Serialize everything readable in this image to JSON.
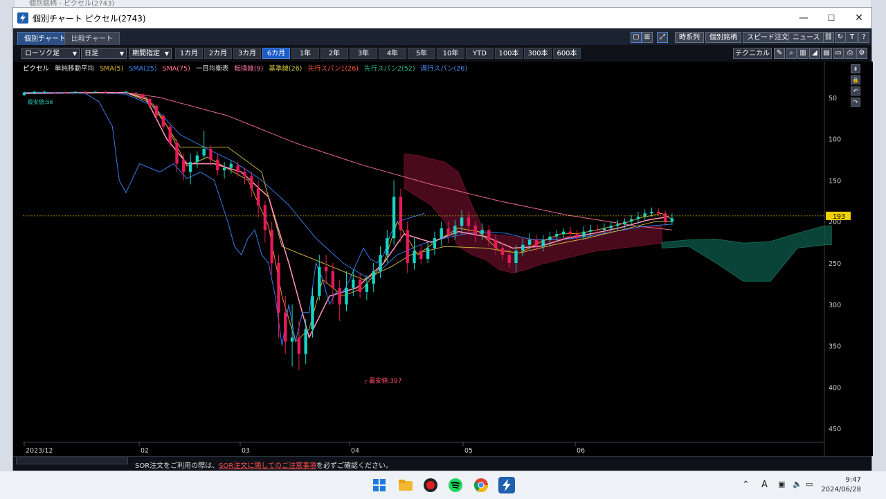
{
  "background_window_title": "個別銘柄 - ピクセル(2743)",
  "window": {
    "title": "個別チャート ピクセル(2743)",
    "min": "—",
    "max": "☐",
    "close": "✕"
  },
  "tabs": [
    {
      "label": "個別チャート"
    },
    {
      "label": "比較チャート"
    }
  ],
  "top_buttons": {
    "time_series": "時系列",
    "individual": "個別銘柄",
    "speed_order": "スピード注文",
    "news": "ニュース"
  },
  "toolbar": {
    "chart_type": "ローソク足",
    "period_type": "日足",
    "range_mode": "期間指定",
    "ranges": [
      "1カ月",
      "2カ月",
      "3カ月",
      "6カ月",
      "1年",
      "2年",
      "3年",
      "4年",
      "5年",
      "10年",
      "YTD",
      "100本",
      "300本",
      "600本"
    ],
    "active_range": "6カ月",
    "technical": "テクニカル"
  },
  "legend": {
    "name": "ピクセル",
    "sma_label": "単純移動平均",
    "sma5": "SMA(5)",
    "sma25": "SMA(25)",
    "sma75": "SMA(75)",
    "ichimoku_label": "一目均衡表",
    "tenkan": "転換線(9)",
    "kijun": "基準線(26)",
    "span1": "先行スパン1(26)",
    "span2": "先行スパン2(52)",
    "chikou": "遅行スパン(26)"
  },
  "colors": {
    "up": "#19d3c5",
    "down": "#e8195a",
    "sma5": "#d9a21b",
    "sma25": "#2f7be8",
    "sma75": "#e86a8e",
    "tenkan": "#ff8fb4",
    "kijun": "#c8b03a",
    "span1": "#e64b28",
    "span2": "#1e9a7a",
    "chikou": "#3d7be6"
  },
  "chart_data": {
    "type": "candlestick",
    "x_ticks": [
      "2023/12",
      "02",
      "03",
      "04",
      "05",
      "06"
    ],
    "y_ticks": [
      50,
      100,
      150,
      200,
      250,
      300,
      350,
      400,
      450
    ],
    "ylim": [
      475,
      30
    ],
    "y_reversed": true,
    "current_price": 193,
    "annotations": {
      "high_marker": "最安値:397",
      "low_marker": "最安値:56"
    },
    "candles": [
      [
        0,
        47,
        44,
        48,
        43
      ],
      [
        3,
        45,
        43,
        46,
        42
      ],
      [
        6,
        44,
        43,
        45,
        42
      ],
      [
        9,
        44,
        44,
        45,
        43
      ],
      [
        12,
        44,
        44,
        45,
        43
      ],
      [
        15,
        44,
        43,
        45,
        42
      ],
      [
        18,
        43,
        44,
        45,
        42
      ],
      [
        21,
        44,
        43,
        45,
        42
      ],
      [
        24,
        43,
        44,
        45,
        42
      ],
      [
        27,
        44,
        44,
        45,
        43
      ],
      [
        30,
        44,
        43,
        45,
        42
      ],
      [
        33,
        44,
        45,
        46,
        43
      ],
      [
        35,
        46,
        50,
        52,
        45
      ],
      [
        37,
        52,
        60,
        63,
        50
      ],
      [
        39,
        60,
        72,
        76,
        58
      ],
      [
        41,
        72,
        85,
        88,
        70
      ],
      [
        43,
        85,
        105,
        110,
        80
      ],
      [
        45,
        105,
        130,
        140,
        100
      ],
      [
        47,
        125,
        140,
        150,
        118
      ],
      [
        49,
        140,
        128,
        155,
        118
      ],
      [
        51,
        128,
        120,
        135,
        115
      ],
      [
        53,
        120,
        112,
        125,
        90
      ],
      [
        55,
        112,
        125,
        132,
        108
      ],
      [
        57,
        125,
        138,
        144,
        118
      ],
      [
        59,
        138,
        135,
        148,
        128
      ],
      [
        61,
        135,
        130,
        142,
        126
      ],
      [
        63,
        132,
        140,
        146,
        128
      ],
      [
        65,
        140,
        145,
        155,
        135
      ],
      [
        67,
        145,
        160,
        170,
        140
      ],
      [
        69,
        160,
        180,
        195,
        150
      ],
      [
        71,
        180,
        210,
        225,
        175
      ],
      [
        73,
        210,
        250,
        265,
        200
      ],
      [
        75,
        250,
        310,
        340,
        240
      ],
      [
        77,
        310,
        345,
        360,
        290
      ],
      [
        79,
        345,
        340,
        375,
        300
      ],
      [
        81,
        340,
        360,
        380,
        320
      ],
      [
        83,
        360,
        330,
        372,
        318
      ],
      [
        85,
        330,
        290,
        340,
        280
      ],
      [
        87,
        290,
        255,
        295,
        240
      ],
      [
        89,
        255,
        260,
        275,
        240
      ],
      [
        91,
        260,
        280,
        300,
        250
      ],
      [
        93,
        280,
        300,
        320,
        270
      ],
      [
        95,
        300,
        280,
        308,
        260
      ],
      [
        97,
        280,
        270,
        290,
        258
      ],
      [
        99,
        270,
        285,
        292,
        262
      ],
      [
        101,
        285,
        275,
        295,
        265
      ],
      [
        103,
        275,
        260,
        285,
        250
      ],
      [
        105,
        260,
        240,
        268,
        230
      ],
      [
        107,
        240,
        220,
        250,
        210
      ],
      [
        109,
        220,
        170,
        228,
        150
      ],
      [
        111,
        170,
        210,
        225,
        160
      ],
      [
        113,
        210,
        250,
        262,
        200
      ],
      [
        115,
        250,
        235,
        258,
        220
      ],
      [
        117,
        235,
        245,
        252,
        228
      ],
      [
        119,
        245,
        232,
        250,
        225
      ],
      [
        121,
        232,
        220,
        240,
        212
      ],
      [
        123,
        220,
        208,
        230,
        200
      ],
      [
        125,
        208,
        215,
        226,
        200
      ],
      [
        127,
        215,
        205,
        222,
        198
      ],
      [
        129,
        205,
        195,
        215,
        186
      ],
      [
        131,
        195,
        205,
        214,
        188
      ],
      [
        133,
        205,
        215,
        225,
        200
      ],
      [
        135,
        215,
        210,
        222,
        202
      ],
      [
        137,
        210,
        222,
        230,
        204
      ],
      [
        139,
        222,
        232,
        240,
        216
      ],
      [
        141,
        232,
        240,
        246,
        226
      ],
      [
        143,
        240,
        250,
        256,
        232
      ],
      [
        145,
        250,
        235,
        262,
        228
      ],
      [
        147,
        235,
        228,
        242,
        220
      ],
      [
        149,
        228,
        222,
        234,
        214
      ],
      [
        151,
        222,
        230,
        236,
        216
      ],
      [
        153,
        230,
        222,
        236,
        216
      ],
      [
        155,
        222,
        218,
        230,
        212
      ],
      [
        157,
        218,
        215,
        224,
        210
      ],
      [
        159,
        215,
        212,
        220,
        208
      ],
      [
        161,
        212,
        215,
        220,
        206
      ],
      [
        163,
        215,
        218,
        222,
        210
      ],
      [
        165,
        218,
        212,
        222,
        206
      ],
      [
        167,
        212,
        210,
        218,
        204
      ],
      [
        169,
        210,
        210,
        215,
        204
      ],
      [
        171,
        210,
        208,
        214,
        202
      ],
      [
        173,
        208,
        205,
        212,
        200
      ],
      [
        175,
        205,
        203,
        210,
        198
      ],
      [
        177,
        203,
        200,
        208,
        196
      ],
      [
        179,
        200,
        197,
        205,
        192
      ],
      [
        181,
        197,
        194,
        202,
        188
      ],
      [
        183,
        194,
        190,
        198,
        185
      ],
      [
        185,
        190,
        188,
        194,
        183
      ],
      [
        187,
        188,
        190,
        193,
        184
      ],
      [
        189,
        190,
        200,
        205,
        186
      ],
      [
        191,
        200,
        196,
        204,
        190
      ]
    ],
    "sma5": [
      [
        0,
        45
      ],
      [
        30,
        44
      ],
      [
        36,
        50
      ],
      [
        42,
        84
      ],
      [
        48,
        133
      ],
      [
        54,
        122
      ],
      [
        60,
        136
      ],
      [
        66,
        150
      ],
      [
        72,
        205
      ],
      [
        76,
        290
      ],
      [
        80,
        345
      ],
      [
        84,
        330
      ],
      [
        88,
        270
      ],
      [
        94,
        290
      ],
      [
        100,
        280
      ],
      [
        106,
        250
      ],
      [
        110,
        200
      ],
      [
        116,
        240
      ],
      [
        122,
        222
      ],
      [
        128,
        208
      ],
      [
        134,
        212
      ],
      [
        140,
        235
      ],
      [
        146,
        238
      ],
      [
        152,
        225
      ],
      [
        158,
        215
      ],
      [
        164,
        214
      ],
      [
        170,
        209
      ],
      [
        176,
        203
      ],
      [
        182,
        195
      ],
      [
        188,
        190
      ],
      [
        191,
        197
      ]
    ],
    "sma25": [
      [
        0,
        44
      ],
      [
        20,
        44
      ],
      [
        30,
        46
      ],
      [
        38,
        60
      ],
      [
        46,
        95
      ],
      [
        54,
        112
      ],
      [
        62,
        128
      ],
      [
        70,
        150
      ],
      [
        78,
        180
      ],
      [
        86,
        220
      ],
      [
        94,
        250
      ],
      [
        102,
        270
      ],
      [
        110,
        240
      ],
      [
        118,
        226
      ],
      [
        126,
        218
      ],
      [
        134,
        212
      ],
      [
        142,
        214
      ],
      [
        150,
        222
      ],
      [
        158,
        222
      ],
      [
        166,
        218
      ],
      [
        174,
        212
      ],
      [
        182,
        206
      ],
      [
        191,
        203
      ]
    ],
    "sma75": [
      [
        0,
        44
      ],
      [
        30,
        44
      ],
      [
        40,
        50
      ],
      [
        60,
        72
      ],
      [
        80,
        105
      ],
      [
        100,
        132
      ],
      [
        120,
        155
      ],
      [
        140,
        175
      ],
      [
        160,
        192
      ],
      [
        180,
        205
      ],
      [
        191,
        210
      ]
    ],
    "tenkan": [
      [
        0,
        45
      ],
      [
        30,
        44
      ],
      [
        36,
        52
      ],
      [
        42,
        100
      ],
      [
        48,
        130
      ],
      [
        56,
        130
      ],
      [
        64,
        140
      ],
      [
        72,
        170
      ],
      [
        78,
        250
      ],
      [
        84,
        340
      ],
      [
        90,
        290
      ],
      [
        98,
        280
      ],
      [
        106,
        250
      ],
      [
        112,
        215
      ],
      [
        120,
        225
      ],
      [
        128,
        212
      ],
      [
        136,
        218
      ],
      [
        144,
        232
      ],
      [
        152,
        230
      ],
      [
        160,
        220
      ],
      [
        168,
        214
      ],
      [
        176,
        207
      ],
      [
        184,
        198
      ],
      [
        190,
        194
      ]
    ],
    "kijun": [
      [
        0,
        44
      ],
      [
        30,
        44
      ],
      [
        38,
        58
      ],
      [
        46,
        110
      ],
      [
        60,
        110
      ],
      [
        70,
        140
      ],
      [
        76,
        230
      ],
      [
        88,
        250
      ],
      [
        100,
        270
      ],
      [
        108,
        255
      ],
      [
        114,
        240
      ],
      [
        124,
        230
      ],
      [
        136,
        232
      ],
      [
        146,
        238
      ],
      [
        156,
        228
      ],
      [
        166,
        220
      ],
      [
        176,
        210
      ],
      [
        186,
        200
      ],
      [
        191,
        200
      ]
    ]
  }
}
